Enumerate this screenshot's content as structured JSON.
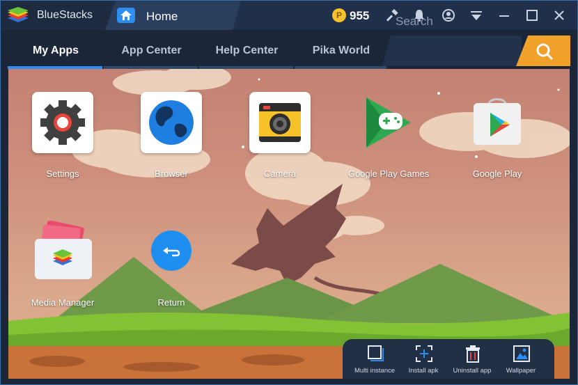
{
  "titlebar": {
    "app_name": "BlueStacks",
    "tab_title": "Home",
    "coins": "955",
    "coin_symbol": "P"
  },
  "nav": {
    "tabs": [
      {
        "label": "My Apps",
        "active": true
      },
      {
        "label": "App Center",
        "active": false
      },
      {
        "label": "Help Center",
        "active": false
      },
      {
        "label": "Pika World",
        "active": false
      }
    ],
    "search_placeholder": "Search"
  },
  "apps": [
    {
      "label": "Settings",
      "icon": "settings-icon"
    },
    {
      "label": "Browser",
      "icon": "browser-icon"
    },
    {
      "label": "Camera",
      "icon": "camera-icon"
    },
    {
      "label": "Google Play Games",
      "icon": "play-games-icon"
    },
    {
      "label": "Google Play",
      "icon": "google-play-icon"
    },
    {
      "label": "Media Manager",
      "icon": "media-manager-icon"
    },
    {
      "label": "Return",
      "icon": "return-icon"
    }
  ],
  "dock": {
    "items": [
      {
        "label": "Multi instance",
        "icon": "multi-instance-icon"
      },
      {
        "label": "Install apk",
        "icon": "install-apk-icon"
      },
      {
        "label": "Uninstall app",
        "icon": "uninstall-icon"
      },
      {
        "label": "Wallpaper",
        "icon": "wallpaper-icon"
      }
    ]
  },
  "colors": {
    "accent": "#2b8ef0",
    "search_button": "#f0a12a",
    "titlebar": "#21304a"
  }
}
